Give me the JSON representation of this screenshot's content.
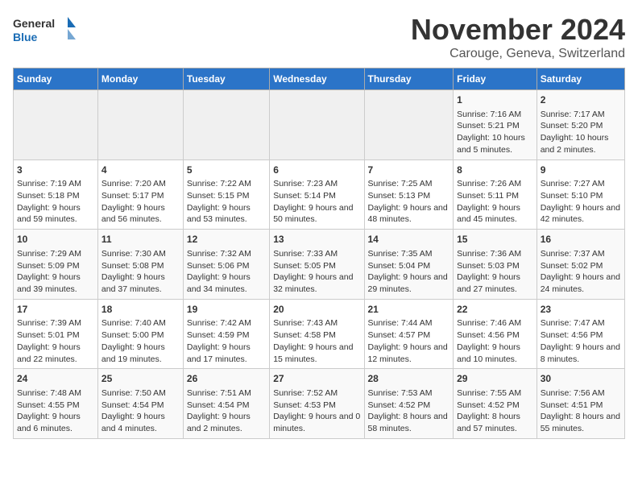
{
  "logo": {
    "text_general": "General",
    "text_blue": "Blue"
  },
  "header": {
    "month": "November 2024",
    "location": "Carouge, Geneva, Switzerland"
  },
  "weekdays": [
    "Sunday",
    "Monday",
    "Tuesday",
    "Wednesday",
    "Thursday",
    "Friday",
    "Saturday"
  ],
  "weeks": [
    [
      {
        "day": "",
        "empty": true
      },
      {
        "day": "",
        "empty": true
      },
      {
        "day": "",
        "empty": true
      },
      {
        "day": "",
        "empty": true
      },
      {
        "day": "",
        "empty": true
      },
      {
        "day": "1",
        "sunrise": "Sunrise: 7:16 AM",
        "sunset": "Sunset: 5:21 PM",
        "daylight": "Daylight: 10 hours and 5 minutes."
      },
      {
        "day": "2",
        "sunrise": "Sunrise: 7:17 AM",
        "sunset": "Sunset: 5:20 PM",
        "daylight": "Daylight: 10 hours and 2 minutes."
      }
    ],
    [
      {
        "day": "3",
        "sunrise": "Sunrise: 7:19 AM",
        "sunset": "Sunset: 5:18 PM",
        "daylight": "Daylight: 9 hours and 59 minutes."
      },
      {
        "day": "4",
        "sunrise": "Sunrise: 7:20 AM",
        "sunset": "Sunset: 5:17 PM",
        "daylight": "Daylight: 9 hours and 56 minutes."
      },
      {
        "day": "5",
        "sunrise": "Sunrise: 7:22 AM",
        "sunset": "Sunset: 5:15 PM",
        "daylight": "Daylight: 9 hours and 53 minutes."
      },
      {
        "day": "6",
        "sunrise": "Sunrise: 7:23 AM",
        "sunset": "Sunset: 5:14 PM",
        "daylight": "Daylight: 9 hours and 50 minutes."
      },
      {
        "day": "7",
        "sunrise": "Sunrise: 7:25 AM",
        "sunset": "Sunset: 5:13 PM",
        "daylight": "Daylight: 9 hours and 48 minutes."
      },
      {
        "day": "8",
        "sunrise": "Sunrise: 7:26 AM",
        "sunset": "Sunset: 5:11 PM",
        "daylight": "Daylight: 9 hours and 45 minutes."
      },
      {
        "day": "9",
        "sunrise": "Sunrise: 7:27 AM",
        "sunset": "Sunset: 5:10 PM",
        "daylight": "Daylight: 9 hours and 42 minutes."
      }
    ],
    [
      {
        "day": "10",
        "sunrise": "Sunrise: 7:29 AM",
        "sunset": "Sunset: 5:09 PM",
        "daylight": "Daylight: 9 hours and 39 minutes."
      },
      {
        "day": "11",
        "sunrise": "Sunrise: 7:30 AM",
        "sunset": "Sunset: 5:08 PM",
        "daylight": "Daylight: 9 hours and 37 minutes."
      },
      {
        "day": "12",
        "sunrise": "Sunrise: 7:32 AM",
        "sunset": "Sunset: 5:06 PM",
        "daylight": "Daylight: 9 hours and 34 minutes."
      },
      {
        "day": "13",
        "sunrise": "Sunrise: 7:33 AM",
        "sunset": "Sunset: 5:05 PM",
        "daylight": "Daylight: 9 hours and 32 minutes."
      },
      {
        "day": "14",
        "sunrise": "Sunrise: 7:35 AM",
        "sunset": "Sunset: 5:04 PM",
        "daylight": "Daylight: 9 hours and 29 minutes."
      },
      {
        "day": "15",
        "sunrise": "Sunrise: 7:36 AM",
        "sunset": "Sunset: 5:03 PM",
        "daylight": "Daylight: 9 hours and 27 minutes."
      },
      {
        "day": "16",
        "sunrise": "Sunrise: 7:37 AM",
        "sunset": "Sunset: 5:02 PM",
        "daylight": "Daylight: 9 hours and 24 minutes."
      }
    ],
    [
      {
        "day": "17",
        "sunrise": "Sunrise: 7:39 AM",
        "sunset": "Sunset: 5:01 PM",
        "daylight": "Daylight: 9 hours and 22 minutes."
      },
      {
        "day": "18",
        "sunrise": "Sunrise: 7:40 AM",
        "sunset": "Sunset: 5:00 PM",
        "daylight": "Daylight: 9 hours and 19 minutes."
      },
      {
        "day": "19",
        "sunrise": "Sunrise: 7:42 AM",
        "sunset": "Sunset: 4:59 PM",
        "daylight": "Daylight: 9 hours and 17 minutes."
      },
      {
        "day": "20",
        "sunrise": "Sunrise: 7:43 AM",
        "sunset": "Sunset: 4:58 PM",
        "daylight": "Daylight: 9 hours and 15 minutes."
      },
      {
        "day": "21",
        "sunrise": "Sunrise: 7:44 AM",
        "sunset": "Sunset: 4:57 PM",
        "daylight": "Daylight: 9 hours and 12 minutes."
      },
      {
        "day": "22",
        "sunrise": "Sunrise: 7:46 AM",
        "sunset": "Sunset: 4:56 PM",
        "daylight": "Daylight: 9 hours and 10 minutes."
      },
      {
        "day": "23",
        "sunrise": "Sunrise: 7:47 AM",
        "sunset": "Sunset: 4:56 PM",
        "daylight": "Daylight: 9 hours and 8 minutes."
      }
    ],
    [
      {
        "day": "24",
        "sunrise": "Sunrise: 7:48 AM",
        "sunset": "Sunset: 4:55 PM",
        "daylight": "Daylight: 9 hours and 6 minutes."
      },
      {
        "day": "25",
        "sunrise": "Sunrise: 7:50 AM",
        "sunset": "Sunset: 4:54 PM",
        "daylight": "Daylight: 9 hours and 4 minutes."
      },
      {
        "day": "26",
        "sunrise": "Sunrise: 7:51 AM",
        "sunset": "Sunset: 4:54 PM",
        "daylight": "Daylight: 9 hours and 2 minutes."
      },
      {
        "day": "27",
        "sunrise": "Sunrise: 7:52 AM",
        "sunset": "Sunset: 4:53 PM",
        "daylight": "Daylight: 9 hours and 0 minutes."
      },
      {
        "day": "28",
        "sunrise": "Sunrise: 7:53 AM",
        "sunset": "Sunset: 4:52 PM",
        "daylight": "Daylight: 8 hours and 58 minutes."
      },
      {
        "day": "29",
        "sunrise": "Sunrise: 7:55 AM",
        "sunset": "Sunset: 4:52 PM",
        "daylight": "Daylight: 8 hours and 57 minutes."
      },
      {
        "day": "30",
        "sunrise": "Sunrise: 7:56 AM",
        "sunset": "Sunset: 4:51 PM",
        "daylight": "Daylight: 8 hours and 55 minutes."
      }
    ]
  ]
}
